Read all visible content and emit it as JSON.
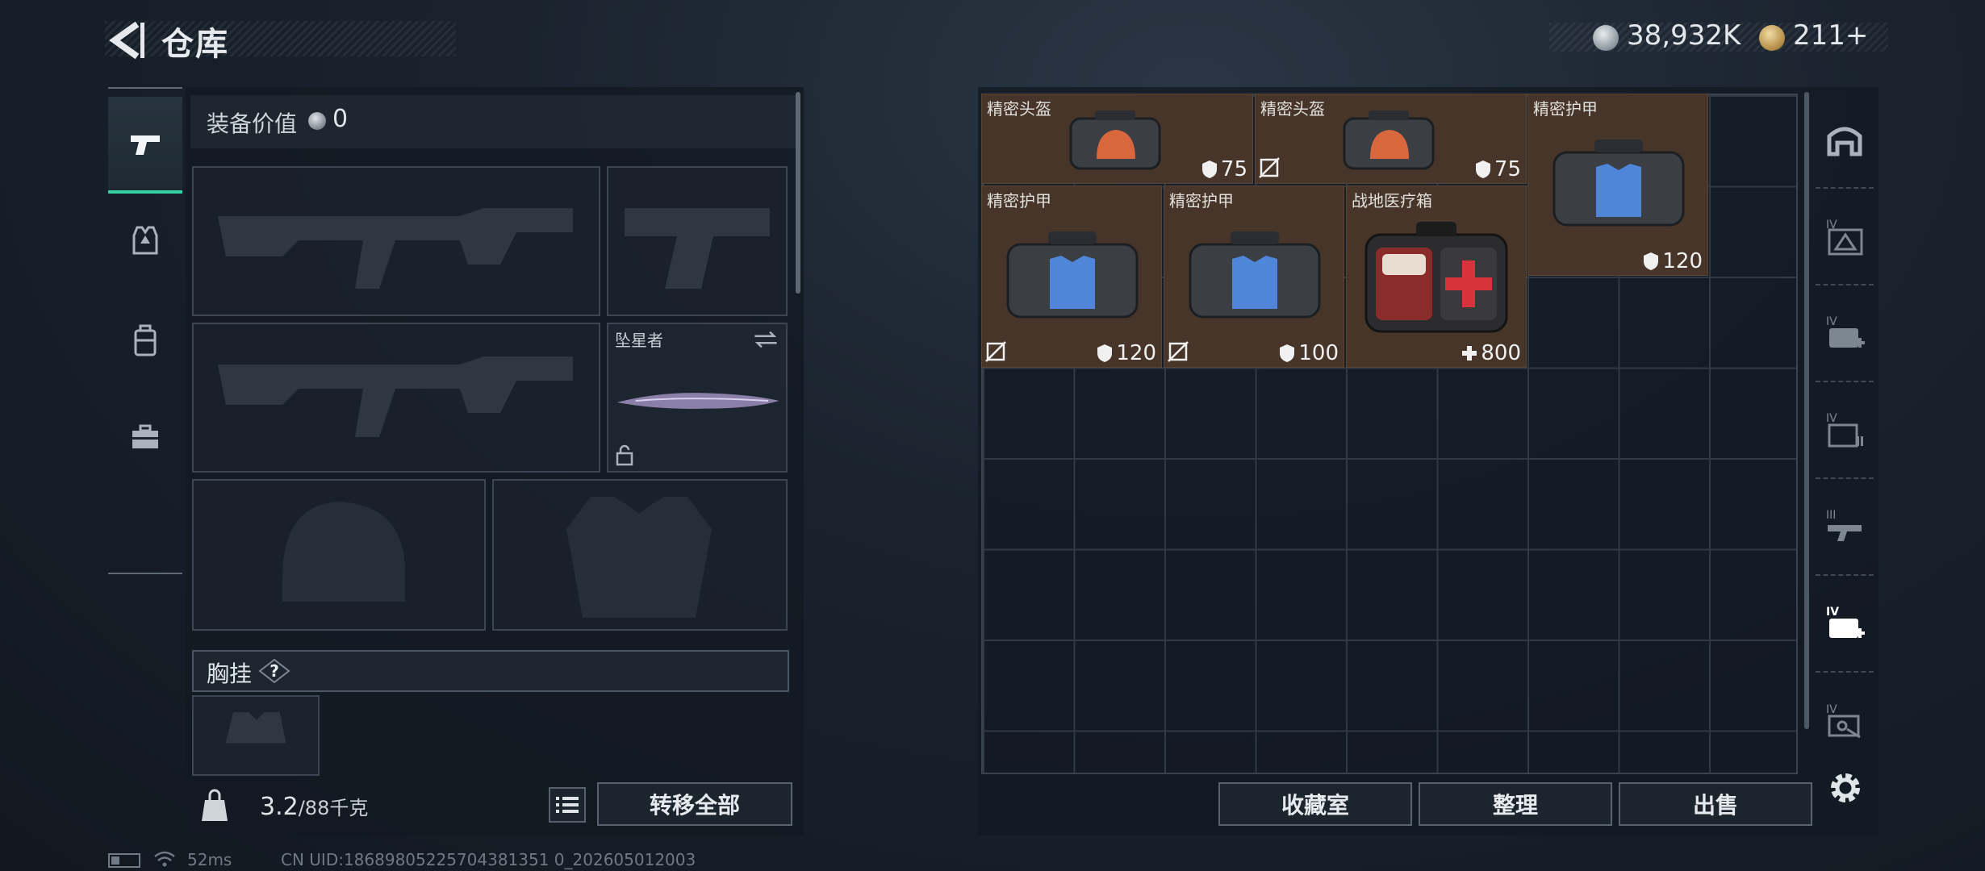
{
  "header": {
    "title": "仓库",
    "currency_silver": "38,932K",
    "currency_gold": "211+"
  },
  "equipment": {
    "value_label": "装备价值",
    "value": "0",
    "knife_name": "坠星者",
    "chest_label": "胸挂",
    "help": "?",
    "weight_current": "3.2",
    "weight_max": "/88千克",
    "transfer_all": "转移全部"
  },
  "storage": {
    "items": [
      {
        "name": "精密头盔",
        "value": "75",
        "icon": "shield-icon",
        "no_repair": false,
        "kind": "helmet"
      },
      {
        "name": "精密头盔",
        "value": "75",
        "icon": "shield-icon",
        "no_repair": true,
        "kind": "helmet"
      },
      {
        "name": "精密护甲",
        "value": "120",
        "icon": "shield-icon",
        "no_repair": false,
        "kind": "armor"
      },
      {
        "name": "精密护甲",
        "value": "120",
        "icon": "shield-icon",
        "no_repair": true,
        "kind": "armor"
      },
      {
        "name": "精密护甲",
        "value": "100",
        "icon": "shield-icon",
        "no_repair": true,
        "kind": "armor"
      },
      {
        "name": "战地医疗箱",
        "value": "800",
        "icon": "plus-icon",
        "no_repair": false,
        "kind": "medkit"
      }
    ],
    "buttons": {
      "collection": "收藏室",
      "organize": "整理",
      "sell": "出售"
    }
  },
  "right_tabs": [
    "home-icon",
    "helmet-filter-icon",
    "medical-filter-icon",
    "ammo-filter-icon",
    "weapon-filter-icon",
    "medical-filter-active-icon",
    "key-filter-icon"
  ],
  "status": {
    "ping": "52ms",
    "uid": "CN UID:18689805225704381351 0_202605012003"
  },
  "colors": {
    "accent": "#35d3a3",
    "item_bg": "#463528"
  }
}
